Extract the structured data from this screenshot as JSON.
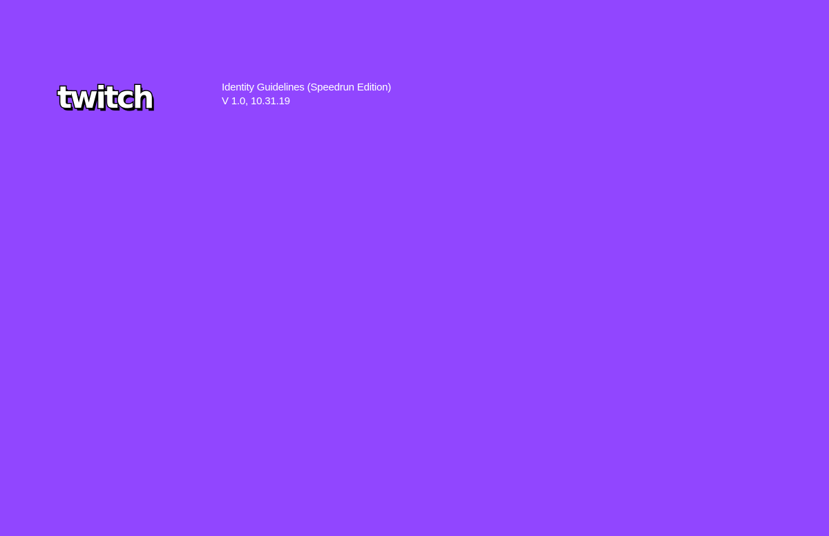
{
  "brand": {
    "logo_text": "twitch",
    "logo_icon": "twitch-wordmark-logo"
  },
  "document": {
    "title": "Identity Guidelines (Speedrun Edition)",
    "version": "V 1.0, 10.31.19"
  },
  "colors": {
    "background": "#9146ff",
    "text": "#ffffff",
    "logo_fill": "#ffffff",
    "logo_outline": "#000000"
  }
}
